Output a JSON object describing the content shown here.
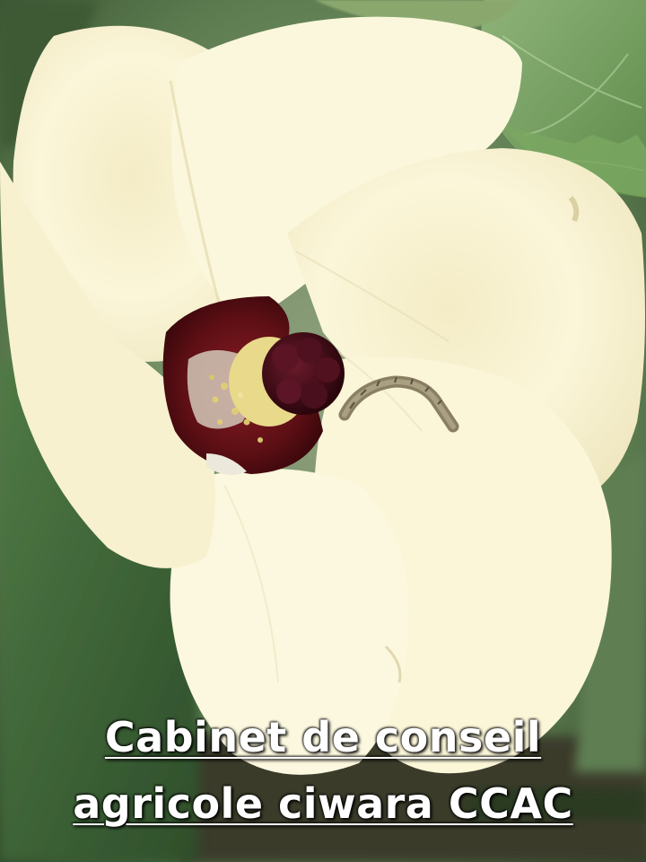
{
  "photo": {
    "subject": "flower-with-caterpillar-photo",
    "colors": {
      "background_leaf": "#5f7f52",
      "petal": "#fbf6d9",
      "petal_shadow": "#e8e1bd",
      "throat": "#5c0f14",
      "stigma": "#3a0a12",
      "pollen": "#e9d98b",
      "caterpillar": "#9a8f72"
    }
  },
  "caption": {
    "line1": "Cabinet de conseil",
    "line2": "agricole ciwara CCAC",
    "color": "#ffffff"
  }
}
